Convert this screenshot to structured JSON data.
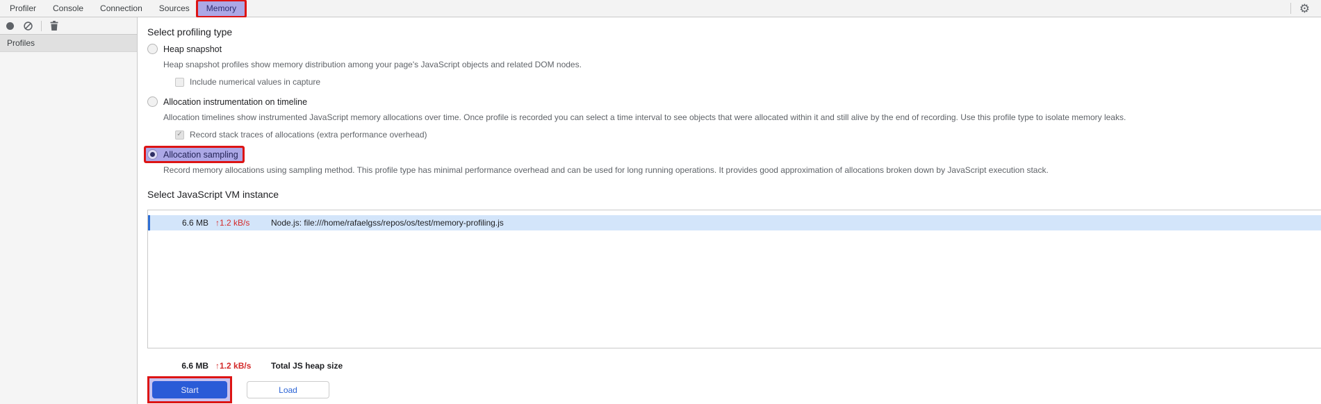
{
  "tabbar": {
    "tabs": [
      {
        "label": "Profiler"
      },
      {
        "label": "Console"
      },
      {
        "label": "Connection"
      },
      {
        "label": "Sources"
      },
      {
        "label": "Memory"
      }
    ],
    "active_tab": "Memory"
  },
  "sidebar": {
    "header": "Profiles"
  },
  "profiling": {
    "heading": "Select profiling type",
    "options": [
      {
        "label": "Heap snapshot",
        "description": "Heap snapshot profiles show memory distribution among your page's JavaScript objects and related DOM nodes.",
        "selected": false,
        "checkbox": {
          "label": "Include numerical values in capture",
          "checked": false
        }
      },
      {
        "label": "Allocation instrumentation on timeline",
        "description": "Allocation timelines show instrumented JavaScript memory allocations over time. Once profile is recorded you can select a time interval to see objects that were allocated within it and still alive by the end of recording. Use this profile type to isolate memory leaks.",
        "selected": false,
        "checkbox": {
          "label": "Record stack traces of allocations (extra performance overhead)",
          "checked": true,
          "disabled": true
        }
      },
      {
        "label": "Allocation sampling",
        "description": "Record memory allocations using sampling method. This profile type has minimal performance overhead and can be used for long running operations. It provides good approximation of allocations broken down by JavaScript execution stack.",
        "selected": true,
        "highlighted": true
      }
    ]
  },
  "vm": {
    "heading": "Select JavaScript VM instance",
    "rows": [
      {
        "heap_size": "6.6 MB",
        "rate": "↑1.2 kB/s",
        "name": "Node.js: file:///home/rafaelgss/repos/os/test/memory-profiling.js",
        "selected": true
      }
    ],
    "footer": {
      "heap_size": "6.6 MB",
      "rate": "↑1.2 kB/s",
      "label": "Total JS heap size"
    }
  },
  "actions": {
    "start_label": "Start",
    "load_label": "Load"
  },
  "colors": {
    "annotation_red": "#dd1414",
    "annotation_purple": "#aca8e6",
    "selected_row_bg": "#d3e5fa",
    "selected_row_stripe": "#2f6fd4",
    "rate_red": "#d32a2a",
    "primary_button_bg": "#2a5bd7",
    "link_blue": "#2a63d5",
    "toolbar_bg": "#f3f3f3"
  }
}
